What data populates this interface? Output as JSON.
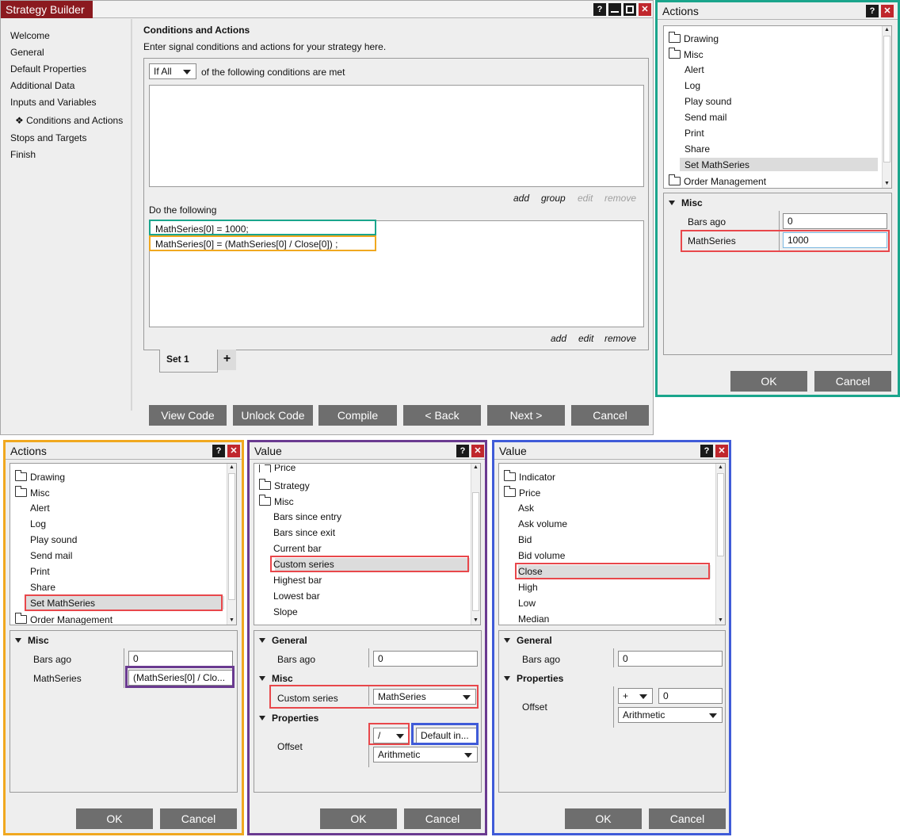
{
  "main": {
    "title": "Strategy Builder",
    "sidebar": [
      "Welcome",
      "General",
      "Default Properties",
      "Additional Data",
      "Inputs and Variables",
      "Conditions and Actions",
      "Stops and Targets",
      "Finish"
    ],
    "sidebar_bullet": "❖",
    "heading": "Conditions and Actions",
    "description": "Enter signal conditions and actions for your strategy here.",
    "condition_select": "If All",
    "condition_text": "of the following conditions are met",
    "cond_links": [
      "add",
      "group",
      "edit",
      "remove"
    ],
    "do_label": "Do the following",
    "actions": [
      "MathSeries[0] = 1000;",
      "MathSeries[0] = (MathSeries[0] / Close[0]) ;"
    ],
    "action_links": [
      "add",
      "edit",
      "remove"
    ],
    "set_tab": "Set 1",
    "add_tab": "+",
    "buttons": [
      "View Code",
      "Unlock Code",
      "Compile",
      "< Back",
      "Next >",
      "Cancel"
    ]
  },
  "actions_right": {
    "title": "Actions",
    "tree": [
      "Drawing",
      "Misc",
      "Alert",
      "Log",
      "Play sound",
      "Send mail",
      "Print",
      "Share",
      "Set MathSeries",
      "Order Management"
    ],
    "section": "Misc",
    "bars_ago_label": "Bars ago",
    "bars_ago_value": "0",
    "mathseries_label": "MathSeries",
    "mathseries_value": "1000",
    "ok": "OK",
    "cancel": "Cancel"
  },
  "actions_bottom": {
    "title": "Actions",
    "tree": [
      "Drawing",
      "Misc",
      "Alert",
      "Log",
      "Play sound",
      "Send mail",
      "Print",
      "Share",
      "Set MathSeries",
      "Order Management"
    ],
    "section": "Misc",
    "bars_ago_label": "Bars ago",
    "bars_ago_value": "0",
    "mathseries_label": "MathSeries",
    "mathseries_value": "(MathSeries[0] / Clo...",
    "ok": "OK",
    "cancel": "Cancel"
  },
  "value_middle": {
    "title": "Value",
    "tree": [
      "Price",
      "Strategy",
      "Misc",
      "Bars since entry",
      "Bars since exit",
      "Current bar",
      "Custom series",
      "Highest bar",
      "Lowest bar",
      "Slope"
    ],
    "general": "General",
    "bars_ago_label": "Bars ago",
    "bars_ago_value": "0",
    "misc": "Misc",
    "custom_series_label": "Custom series",
    "custom_series_value": "MathSeries",
    "properties": "Properties",
    "offset_label": "Offset",
    "offset_op": "/",
    "offset_value": "Default in...",
    "offset_type": "Arithmetic",
    "ok": "OK",
    "cancel": "Cancel"
  },
  "value_right": {
    "title": "Value",
    "tree": [
      "Indicator",
      "Price",
      "Ask",
      "Ask volume",
      "Bid",
      "Bid volume",
      "Close",
      "High",
      "Low",
      "Median"
    ],
    "general": "General",
    "bars_ago_label": "Bars ago",
    "bars_ago_value": "0",
    "properties": "Properties",
    "offset_label": "Offset",
    "offset_op": "+",
    "offset_value": "0",
    "offset_type": "Arithmetic",
    "ok": "OK",
    "cancel": "Cancel"
  },
  "colors": {
    "teal": "#1aa58c",
    "orange": "#f0a820",
    "purple": "#6a3a90",
    "blue": "#3f5bd8",
    "red": "#e8474b",
    "title_red": "#8b1a1f"
  }
}
